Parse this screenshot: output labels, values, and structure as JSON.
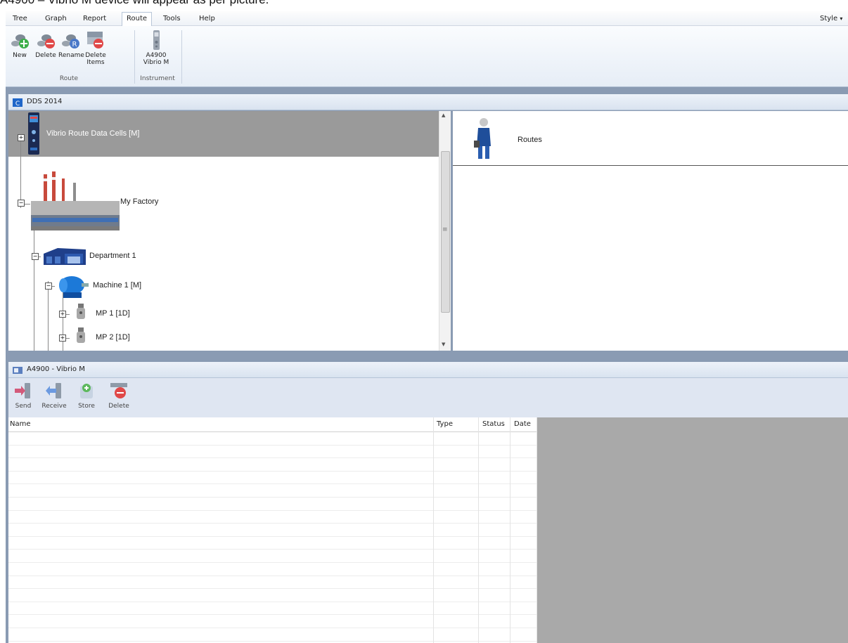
{
  "caption": "A4900 – Vibrio M device will appear as per picture.",
  "menu": {
    "items": [
      {
        "label": "Tree"
      },
      {
        "label": "Graph"
      },
      {
        "label": "Report"
      },
      {
        "label": "Route",
        "active": true
      },
      {
        "label": "Tools"
      },
      {
        "label": "Help"
      }
    ],
    "style_label": "Style",
    "style_chevron": "▾"
  },
  "ribbon": {
    "route_group": {
      "label": "Route",
      "buttons": [
        {
          "label": "New",
          "icon": "route-new-icon"
        },
        {
          "label": "Delete",
          "icon": "route-delete-icon"
        },
        {
          "label": "Rename",
          "icon": "route-rename-icon"
        },
        {
          "label_line1": "Delete",
          "label_line2": "Items",
          "icon": "delete-items-icon"
        }
      ]
    },
    "instrument_group": {
      "label": "Instrument",
      "button": {
        "label_line1": "A4900",
        "label_line2": "Vibrio M",
        "icon": "vibrio-device-icon"
      }
    }
  },
  "tree_panel": {
    "title": "DDS 2014",
    "nodes": [
      {
        "label": "Vibrio Route Data Cells [M]",
        "expander": "+",
        "selected": true,
        "icon": "vibrio-device-icon"
      },
      {
        "label": "My Factory",
        "expander": "−",
        "icon": "factory-icon"
      },
      {
        "label": "Department 1",
        "expander": "−",
        "icon": "department-building-icon"
      },
      {
        "label": "Machine 1 [M]",
        "expander": "−",
        "icon": "motor-icon"
      },
      {
        "label": "MP 1 [1D]",
        "expander": "+",
        "icon": "sensor-icon"
      },
      {
        "label": "MP 2 [1D]",
        "expander": "+",
        "icon": "sensor-icon"
      }
    ],
    "scroll_up": "▲",
    "scroll_down": "▼",
    "scroll_grip": "≡"
  },
  "detail_panel": {
    "title": "Routes",
    "icon": "route-walker-icon"
  },
  "instrument_panel": {
    "title": "A4900 - Vibrio M",
    "toolbar": [
      {
        "label": "Send",
        "icon": "send-icon"
      },
      {
        "label": "Receive",
        "icon": "receive-icon"
      },
      {
        "label": "Store",
        "icon": "store-icon"
      },
      {
        "label": "Delete",
        "icon": "delete-icon"
      }
    ],
    "columns": [
      "Name",
      "Type",
      "Status",
      "Date"
    ]
  },
  "colors": {
    "selection": "#9a9a9a",
    "frame": "#8a9bb3",
    "toolbar_bg": "#dfe6f2",
    "empty_area": "#a9a9a9"
  }
}
